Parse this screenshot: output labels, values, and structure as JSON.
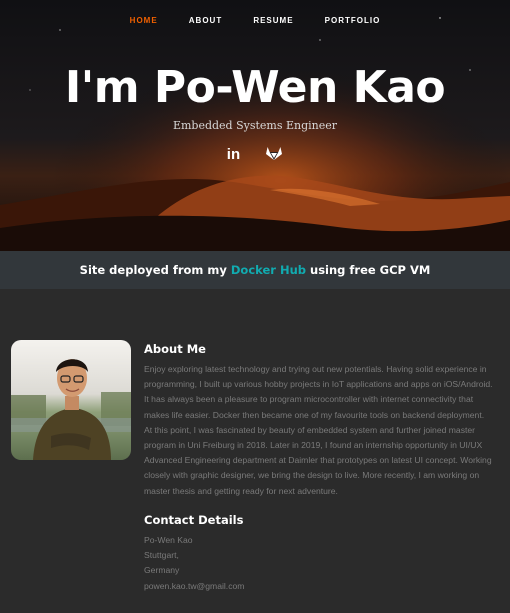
{
  "nav": {
    "items": [
      {
        "label": "HOME",
        "active": true
      },
      {
        "label": "ABOUT",
        "active": false
      },
      {
        "label": "RESUME",
        "active": false
      },
      {
        "label": "PORTFOLIO",
        "active": false
      }
    ]
  },
  "hero": {
    "title": "I'm Po-Wen Kao",
    "subtitle": "Embedded Systems Engineer",
    "social": [
      {
        "icon": "linkedin-icon",
        "label": "in"
      },
      {
        "icon": "gitlab-icon"
      }
    ]
  },
  "banner": {
    "prefix": "Site deployed from my ",
    "link_text": "Docker Hub",
    "suffix": " using free GCP VM"
  },
  "about": {
    "heading": "About Me",
    "body": "Enjoy exploring latest technology and trying out new potentials. Having solid experience in programming, I built up various hobby projects in IoT applications and apps on iOS/Android. It has always been a pleasure to program microcontroller with internet connectivity that makes life easier. Docker then became one of my favourite tools on backend deployment. At this point, I was fascinated by beauty of embedded system and further joined master program in Uni Freiburg in 2018. Later in 2019, I found an internship opportunity in UI/UX Advanced Engineering department at Daimler that prototypes on latest UI concept. Working closely with graphic designer, we bring the design to live. More recently, I am working on master thesis and getting ready for next adventure."
  },
  "contact": {
    "heading": "Contact Details",
    "name": "Po-Wen Kao",
    "city": "Stuttgart,",
    "country": "Germany",
    "email": "powen.kao.tw@gmail.com"
  },
  "colors": {
    "accent": "#f06000",
    "link": "#11abb0",
    "background": "#2b2b2b",
    "banner_bg": "#32373b"
  }
}
